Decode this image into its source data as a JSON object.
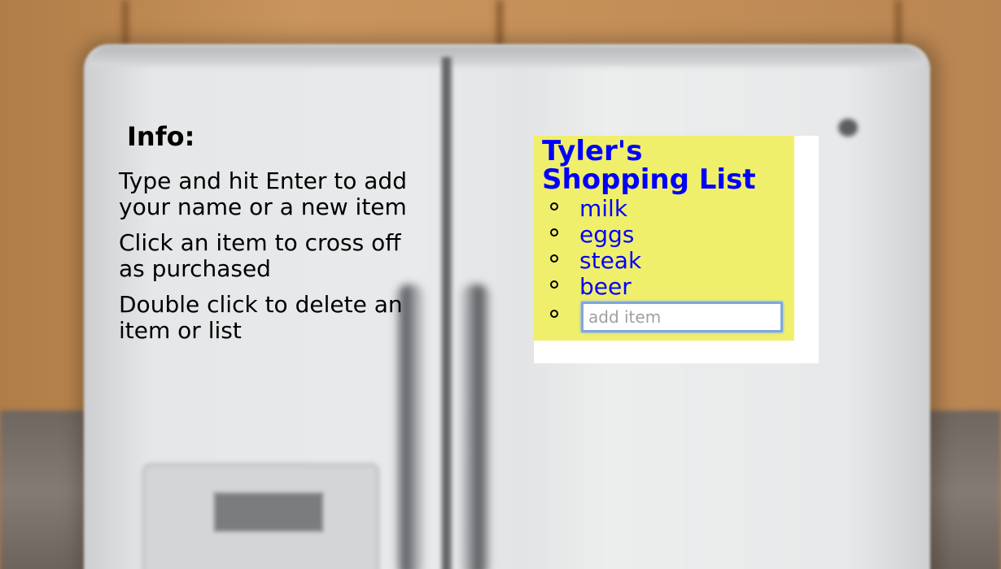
{
  "info": {
    "heading": "Info:",
    "lines": [
      "Type and hit Enter to add your name or a new item",
      "Click an item to cross off as purchased",
      "Double click to delete an item or list"
    ]
  },
  "list": {
    "title": "Tyler's Shopping List",
    "items": [
      {
        "label": "milk"
      },
      {
        "label": "eggs"
      },
      {
        "label": "steak"
      },
      {
        "label": "beer"
      }
    ],
    "add_item_placeholder": "add item",
    "add_item_value": ""
  },
  "colors": {
    "note_background": "#f0ef6c",
    "list_text": "#0000ff",
    "info_text": "#000000"
  }
}
